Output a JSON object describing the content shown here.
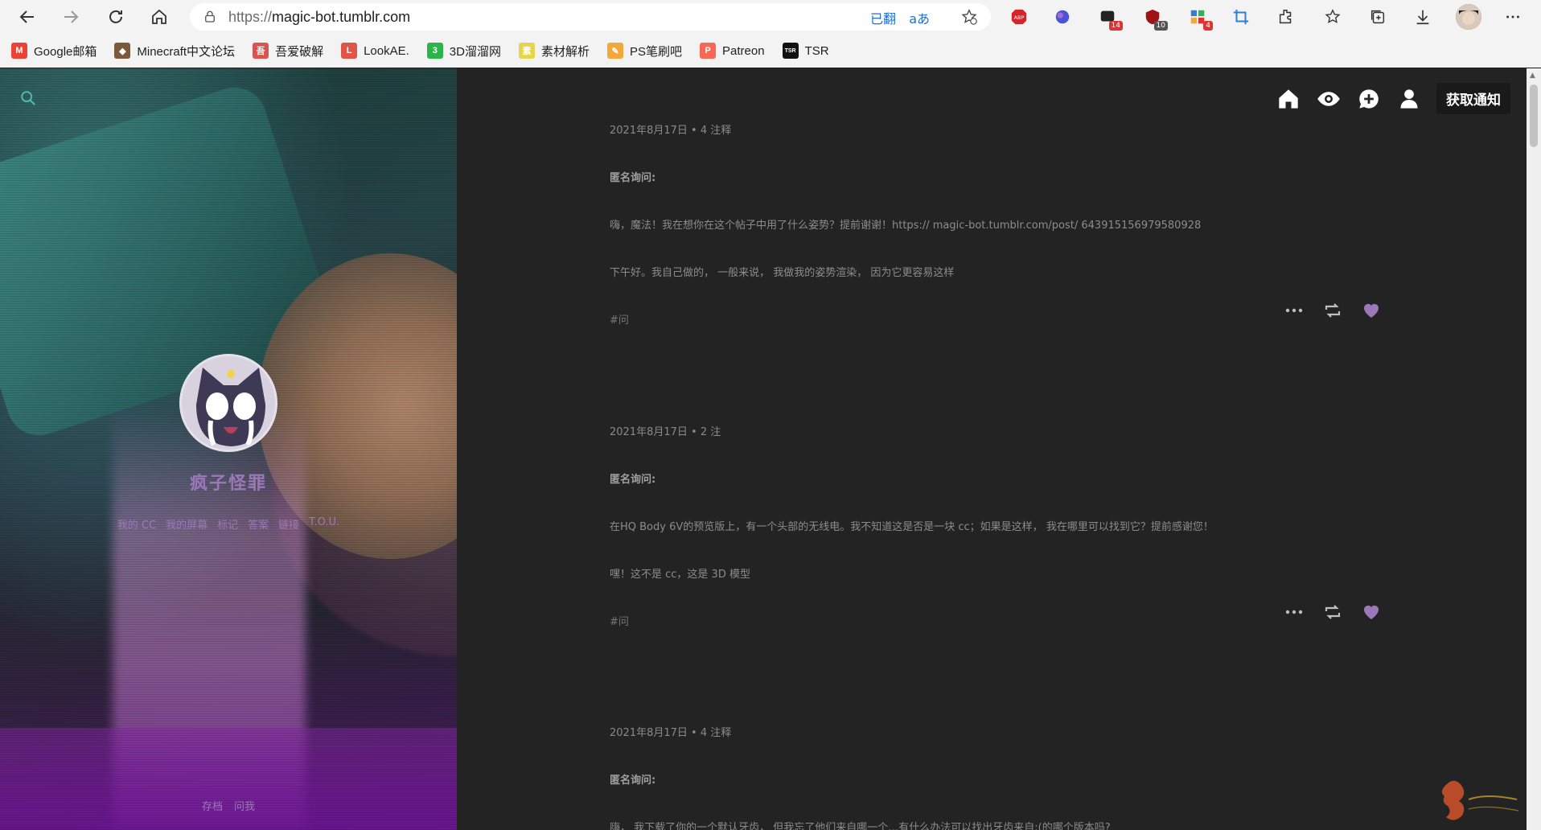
{
  "browser": {
    "url_proto": "https://",
    "url_host": "magic-bot.tumblr.com",
    "translated_label": "已翻",
    "read_aloud_label": "aあ",
    "extensions": [
      {
        "name": "adblock-plus-icon",
        "badge": ""
      },
      {
        "name": "extension-blue-icon",
        "badge": ""
      },
      {
        "name": "chat-extension-icon",
        "badge": "14"
      },
      {
        "name": "ublock-icon",
        "badge": "10"
      },
      {
        "name": "extension-grid-icon",
        "badge": "4"
      },
      {
        "name": "extension-crop-icon",
        "badge": ""
      }
    ]
  },
  "bookmarks": [
    {
      "label": "Google邮箱",
      "color": "#ea4335",
      "glyph": "M"
    },
    {
      "label": "Minecraft中文论坛",
      "color": "#7a5a3a",
      "glyph": "◆"
    },
    {
      "label": "吾爱破解",
      "color": "#d9534f",
      "glyph": "吾"
    },
    {
      "label": "LookAE.",
      "color": "#e0554a",
      "glyph": "L"
    },
    {
      "label": "3D溜溜网",
      "color": "#2cb34a",
      "glyph": "3"
    },
    {
      "label": "素材解析",
      "color": "#e5d54c",
      "glyph": "素"
    },
    {
      "label": "PS笔刷吧",
      "color": "#f2a83b",
      "glyph": "✎"
    },
    {
      "label": "Patreon",
      "color": "#f96854",
      "glyph": "P"
    },
    {
      "label": "TSR",
      "color": "#111111",
      "glyph": "TSR"
    }
  ],
  "blog": {
    "title": "疯子怪罪",
    "links": [
      "我的 CC",
      "我的屏幕",
      "标记",
      "答案",
      "链接",
      "T.O.U."
    ],
    "footer": [
      "存档",
      "问我"
    ],
    "accent": "#9b79b8"
  },
  "topnav": {
    "notify_label": "获取通知"
  },
  "posts": [
    {
      "meta": "2021年8月17日 • 4 注释",
      "asker": "匿名询问:",
      "question": "嗨，魔法！我在想你在这个帖子中用了什么姿势？提前谢谢！https:// magic-bot.tumblr.com/post/ 643915156979580928",
      "answer": "下午好。我自己做的， 一般来说， 我做我的姿势渲染， 因为它更容易这样",
      "tag": "#问"
    },
    {
      "meta": "2021年8月17日 • 2 注",
      "asker": "匿名询问:",
      "question": "在HQ Body 6V的预览版上，有一个头部的无线电。我不知道这是否是一块 cc；如果是这样， 我在哪里可以找到它？提前感谢您！",
      "answer": "嘿！这不是 cc，这是 3D 模型",
      "tag": "#问"
    },
    {
      "meta": "2021年8月17日 • 4 注释",
      "asker": "匿名询问:",
      "question": "嗨， 我下载了你的一个默认牙齿， 但我忘了他们来自哪一个…有什么办法可以找出牙齿来自:(的哪个版本吗?",
      "answer": "",
      "tag": ""
    }
  ],
  "colors": {
    "heart": "#9b79b8",
    "action": "#bfbfbf"
  }
}
